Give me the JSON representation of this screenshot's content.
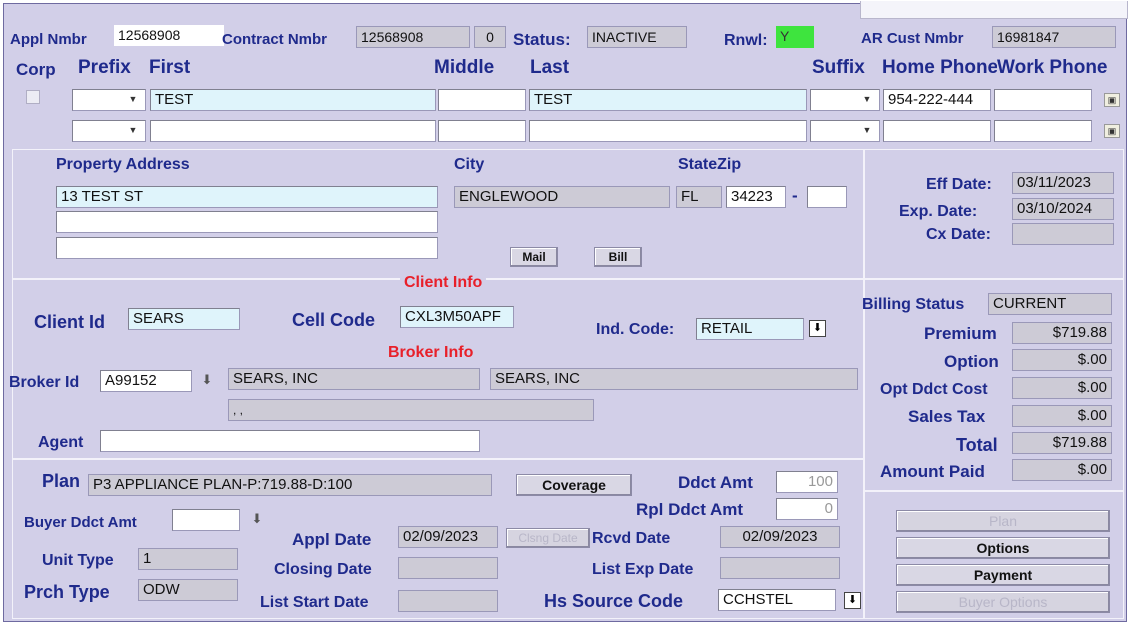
{
  "header": {
    "appl_nmbr_label": "Appl Nmbr",
    "appl_nmbr_value": "12568908",
    "contract_nmbr_label": "Contract Nmbr",
    "contract_nmbr_value": "12568908",
    "contract_seq_value": "0",
    "status_label": "Status:",
    "status_value": "INACTIVE",
    "rnwl_label": "Rnwl:",
    "rnwl_value": "Y",
    "ar_cust_label": "AR Cust Nmbr",
    "ar_cust_value": "16981847"
  },
  "name_cols": {
    "corp": "Corp",
    "prefix": "Prefix",
    "first": "First",
    "middle": "Middle",
    "last": "Last",
    "suffix": "Suffix",
    "home_phone": "Home Phone",
    "work_phone": "Work Phone"
  },
  "name_rows": [
    {
      "first": "TEST",
      "middle": "",
      "last": "TEST",
      "home_phone": "954-222-444",
      "work_phone": ""
    },
    {
      "first": "",
      "middle": "",
      "last": "",
      "home_phone": "",
      "work_phone": ""
    }
  ],
  "address": {
    "property_address_label": "Property Address",
    "line1": "13 TEST ST",
    "line2": "",
    "line3": "",
    "city_label": "City",
    "city_value": "ENGLEWOOD",
    "state_zip_label": "StateZip",
    "state_value": "FL",
    "zip_value": "34223",
    "zip_sep": "-",
    "zip_ext": "",
    "mail_button": "Mail",
    "bill_button": "Bill"
  },
  "dates": {
    "eff_date_label": "Eff Date:",
    "eff_date_value": "03/11/2023",
    "exp_date_label": "Exp. Date:",
    "exp_date_value": "03/10/2024",
    "cx_date_label": "Cx Date:",
    "cx_date_value": ""
  },
  "client": {
    "section_title": "Client Info",
    "client_id_label": "Client Id",
    "client_id_value": "SEARS",
    "cell_code_label": "Cell Code",
    "cell_code_value": "CXL3M50APF",
    "ind_code_label": "Ind. Code:",
    "ind_code_value": "RETAIL"
  },
  "broker": {
    "section_title": "Broker Info",
    "broker_id_label": "Broker Id",
    "broker_id_value": "A99152",
    "broker_name1": "SEARS, INC",
    "broker_name2": "SEARS, INC",
    "broker_addr": ", ,",
    "agent_label": "Agent",
    "agent_value": ""
  },
  "billing": {
    "billing_status_label": "Billing Status",
    "billing_status_value": "CURRENT",
    "premium_label": "Premium",
    "premium_value": "$719.88",
    "option_label": "Option",
    "option_value": "$.00",
    "opt_ddct_label": "Opt Ddct Cost",
    "opt_ddct_value": "$.00",
    "sales_tax_label": "Sales Tax",
    "sales_tax_value": "$.00",
    "total_label": "Total",
    "total_value": "$719.88",
    "amount_paid_label": "Amount Paid",
    "amount_paid_value": "$.00"
  },
  "plan": {
    "plan_label": "Plan",
    "plan_value": "P3 APPLIANCE PLAN-P:719.88-D:100",
    "coverage_button": "Coverage",
    "ddct_amt_label": "Ddct Amt",
    "ddct_amt_value": "100",
    "rpl_ddct_label": "Rpl Ddct Amt",
    "rpl_ddct_value": "0",
    "buyer_ddct_label": "Buyer Ddct Amt",
    "buyer_ddct_value": "",
    "appl_date_label": "Appl Date",
    "appl_date_value": "02/09/2023",
    "clsng_date_button": "Clsng Date",
    "rcvd_date_label": "Rcvd Date",
    "rcvd_date_value": "02/09/2023",
    "unit_type_label": "Unit Type",
    "unit_type_value": "1",
    "closing_date_label": "Closing Date",
    "closing_date_value": "",
    "list_exp_label": "List Exp Date",
    "list_exp_value": "",
    "prch_type_label": "Prch Type",
    "prch_type_value": "ODW",
    "list_start_label": "List Start Date",
    "list_start_value": "",
    "hs_source_label": "Hs Source Code",
    "hs_source_value": "CCHSTEL"
  },
  "actions": {
    "plan_button": "Plan",
    "options_button": "Options",
    "payment_button": "Payment",
    "buyer_options_button": "Buyer Options"
  }
}
